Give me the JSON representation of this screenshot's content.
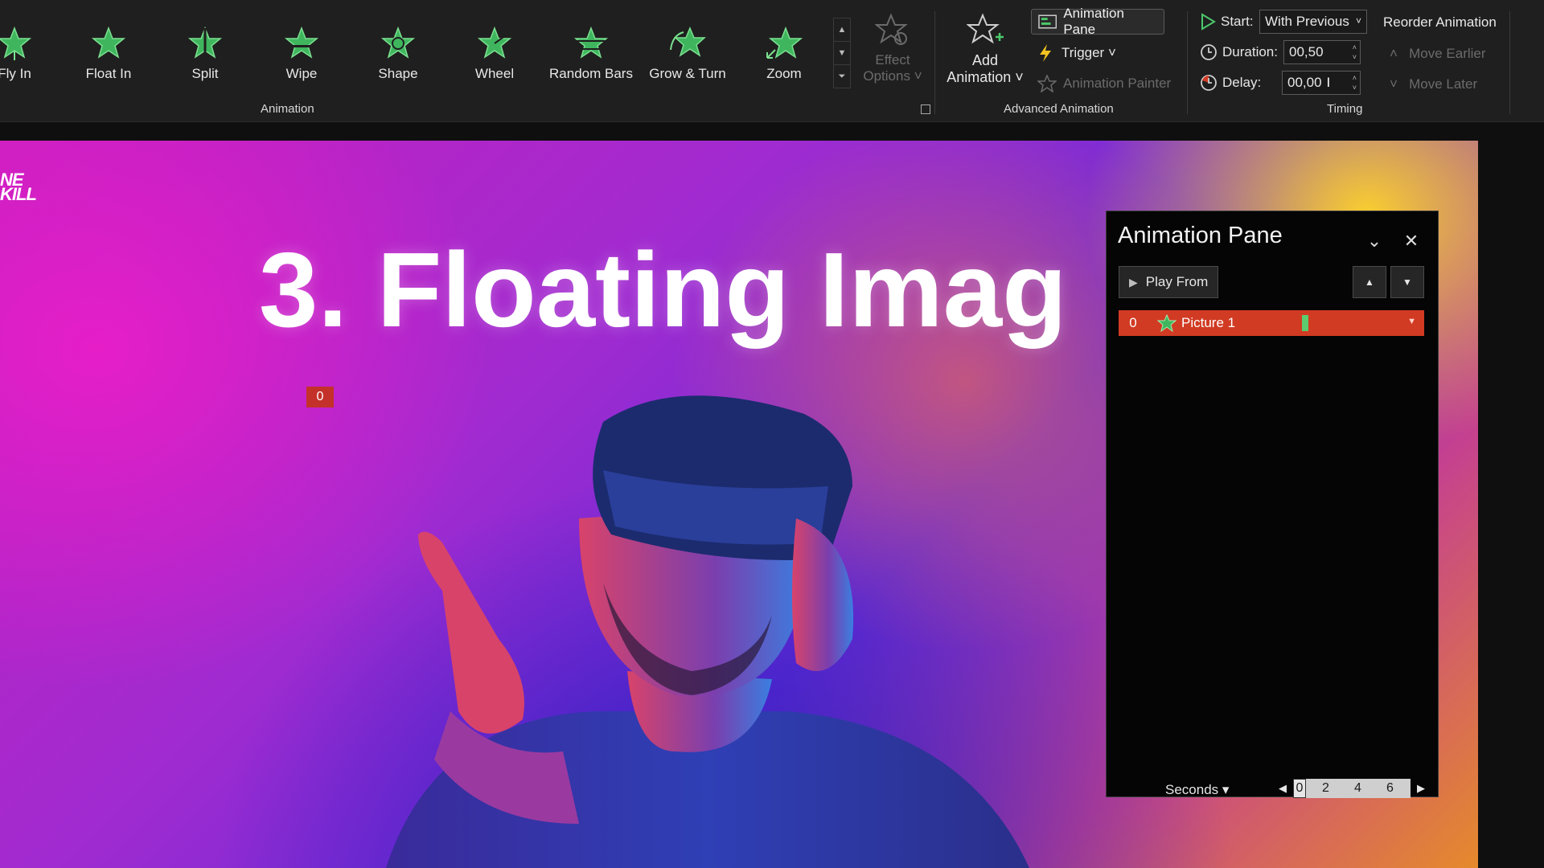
{
  "ribbon": {
    "animations": [
      {
        "label": "Fly In",
        "icon": "fly-in-icon"
      },
      {
        "label": "Float In",
        "icon": "float-in-icon"
      },
      {
        "label": "Split",
        "icon": "split-icon"
      },
      {
        "label": "Wipe",
        "icon": "wipe-icon"
      },
      {
        "label": "Shape",
        "icon": "shape-icon"
      },
      {
        "label": "Wheel",
        "icon": "wheel-icon"
      },
      {
        "label": "Random Bars",
        "icon": "random-bars-icon"
      },
      {
        "label": "Grow & Turn",
        "icon": "grow-turn-icon"
      },
      {
        "label": "Zoom",
        "icon": "zoom-icon"
      }
    ],
    "group_animation": "Animation",
    "effect_options_line1": "Effect",
    "effect_options_line2": "Options",
    "add_animation_line1": "Add",
    "add_animation_line2": "Animation",
    "animation_pane_btn": "Animation Pane",
    "trigger": "Trigger",
    "animation_painter": "Animation Painter",
    "group_advanced": "Advanced Animation",
    "start_label": "Start:",
    "start_value": "With Previous",
    "duration_label": "Duration:",
    "duration_value": "00,50",
    "delay_label": "Delay:",
    "delay_value": "00,00",
    "group_timing": "Timing",
    "reorder_title": "Reorder Animation",
    "move_earlier": "Move Earlier",
    "move_later": "Move Later"
  },
  "slide": {
    "logo_line1": "NE",
    "logo_line2": "KILL",
    "title": "3. Floating Imag",
    "marker": "0"
  },
  "pane": {
    "title": "Animation Pane",
    "play_from": "Play From",
    "item_number": "0",
    "item_name": "Picture 1",
    "seconds": "Seconds",
    "ticks": [
      "0",
      "2",
      "4",
      "6"
    ]
  },
  "colors": {
    "accent_green": "#4cc86a",
    "item_red": "#d13b23",
    "ribbon_bg": "#1f1f1f"
  }
}
